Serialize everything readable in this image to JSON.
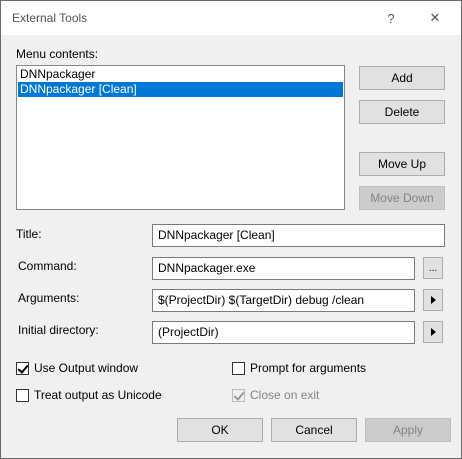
{
  "window": {
    "title": "External Tools",
    "help_glyph": "?",
    "close_glyph": "✕"
  },
  "menu": {
    "label": "Menu contents:",
    "items": [
      {
        "label": "DNNpackager",
        "selected": false
      },
      {
        "label": "DNNpackager [Clean]",
        "selected": true
      }
    ]
  },
  "buttons": {
    "add": "Add",
    "delete": "Delete",
    "move_up": "Move Up",
    "move_down": "Move Down",
    "ok": "OK",
    "cancel": "Cancel",
    "apply": "Apply",
    "browse": "..."
  },
  "fields": {
    "title_label": "Title:",
    "title_value": "DNNpackager [Clean]",
    "command_label": "Command:",
    "command_value": "DNNpackager.exe",
    "arguments_label": "Arguments:",
    "arguments_value": "$(ProjectDir) $(TargetDir) debug /clean",
    "initdir_label": "Initial directory:",
    "initdir_value": "(ProjectDir)"
  },
  "options": {
    "use_output_window": {
      "label": "Use Output window",
      "checked": true,
      "enabled": true
    },
    "prompt_for_arguments": {
      "label": "Prompt for arguments",
      "checked": false,
      "enabled": true
    },
    "treat_output_unicode": {
      "label": "Treat output as Unicode",
      "checked": false,
      "enabled": true
    },
    "close_on_exit": {
      "label": "Close on exit",
      "checked": true,
      "enabled": false
    }
  },
  "colors": {
    "selection": "#0078d7",
    "dialog_bg": "#f0f0f0",
    "disabled_text": "#838383"
  }
}
